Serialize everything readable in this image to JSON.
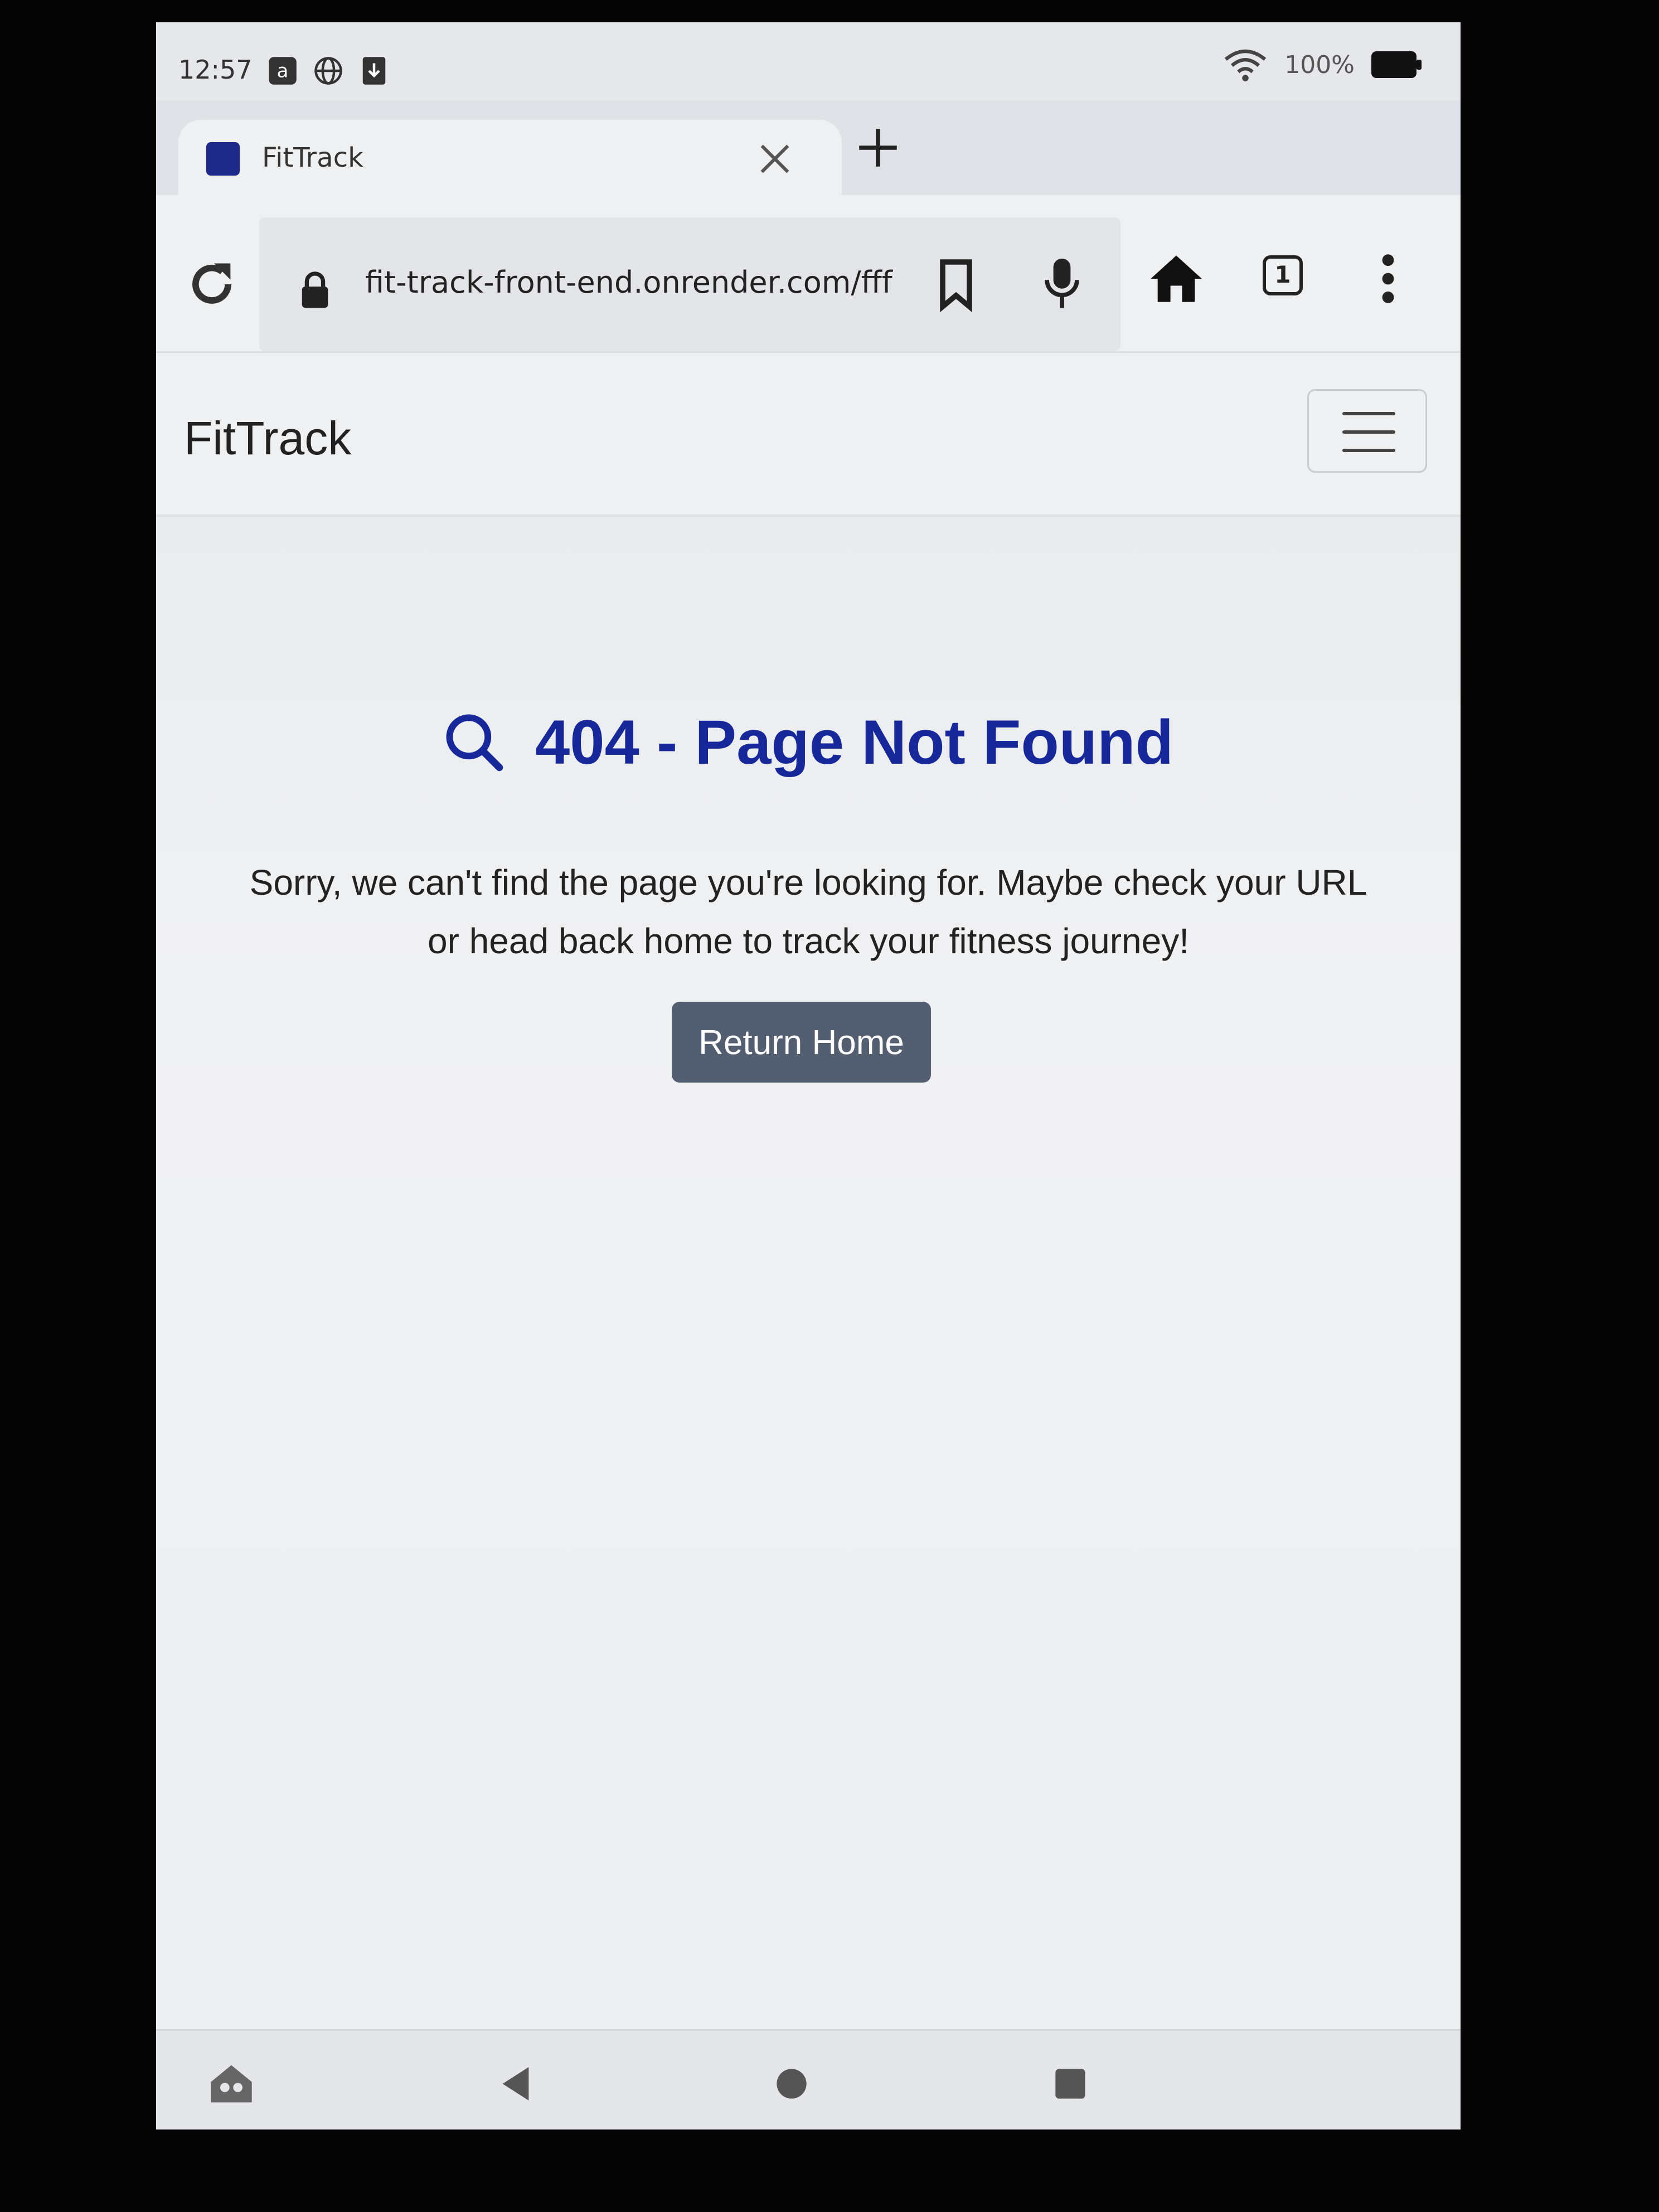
{
  "status_bar": {
    "time": "12:57",
    "battery": "100%"
  },
  "tab": {
    "title": "FitTrack"
  },
  "toolbar": {
    "url": "fit-track-front-end.onrender.com/fff",
    "tabs_count": "1"
  },
  "site": {
    "brand": "FitTrack"
  },
  "main": {
    "heading": "404 - Page Not Found",
    "message": "Sorry, we can't find the page you're looking for. Maybe check your URL or head back home to track your fitness journey!",
    "button_label": "Return Home"
  },
  "colors": {
    "heading": "#17289a",
    "button": "#535e70"
  }
}
